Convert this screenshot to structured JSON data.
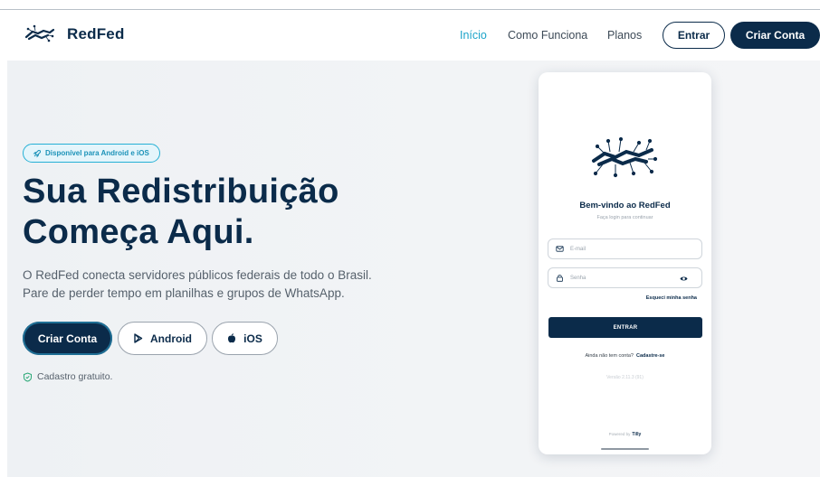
{
  "brand": {
    "name": "RedFed",
    "logo_icon": "handshake-circuit-logo"
  },
  "nav": {
    "links": [
      {
        "label": "Início",
        "active": true
      },
      {
        "label": "Como Funciona",
        "active": false
      },
      {
        "label": "Planos",
        "active": false
      }
    ],
    "login_label": "Entrar",
    "signup_label": "Criar Conta"
  },
  "hero": {
    "badge": "Disponível para Android e iOS",
    "badge_icon": "rocket-icon",
    "headline_line1": "Sua Redistribuição",
    "headline_line2": "Começa Aqui.",
    "lead_line1": "O RedFed conecta servidores públicos federais de todo o Brasil.",
    "lead_line2": "Pare de perder tempo em planilhas e grupos de WhatsApp.",
    "cta_primary": "Criar Conta",
    "cta_android": "Android",
    "cta_ios": "iOS",
    "free_note": "Cadastro gratuito."
  },
  "phone": {
    "welcome": "Bem-vindo ao RedFed",
    "subtitle": "Faça login para continuar",
    "email_placeholder": "E-mail",
    "password_placeholder": "Senha",
    "forgot": "Esqueci minha senha",
    "submit": "ENTRAR",
    "no_account": "Ainda não tem conta?",
    "signup_link": "Cadastre-se",
    "version": "Versão 2.11.3 (91)",
    "powered_by": "Powered by",
    "powered_brand": "Tilly"
  },
  "colors": {
    "navy": "#0b2b4a",
    "accent": "#1aa3c9"
  }
}
